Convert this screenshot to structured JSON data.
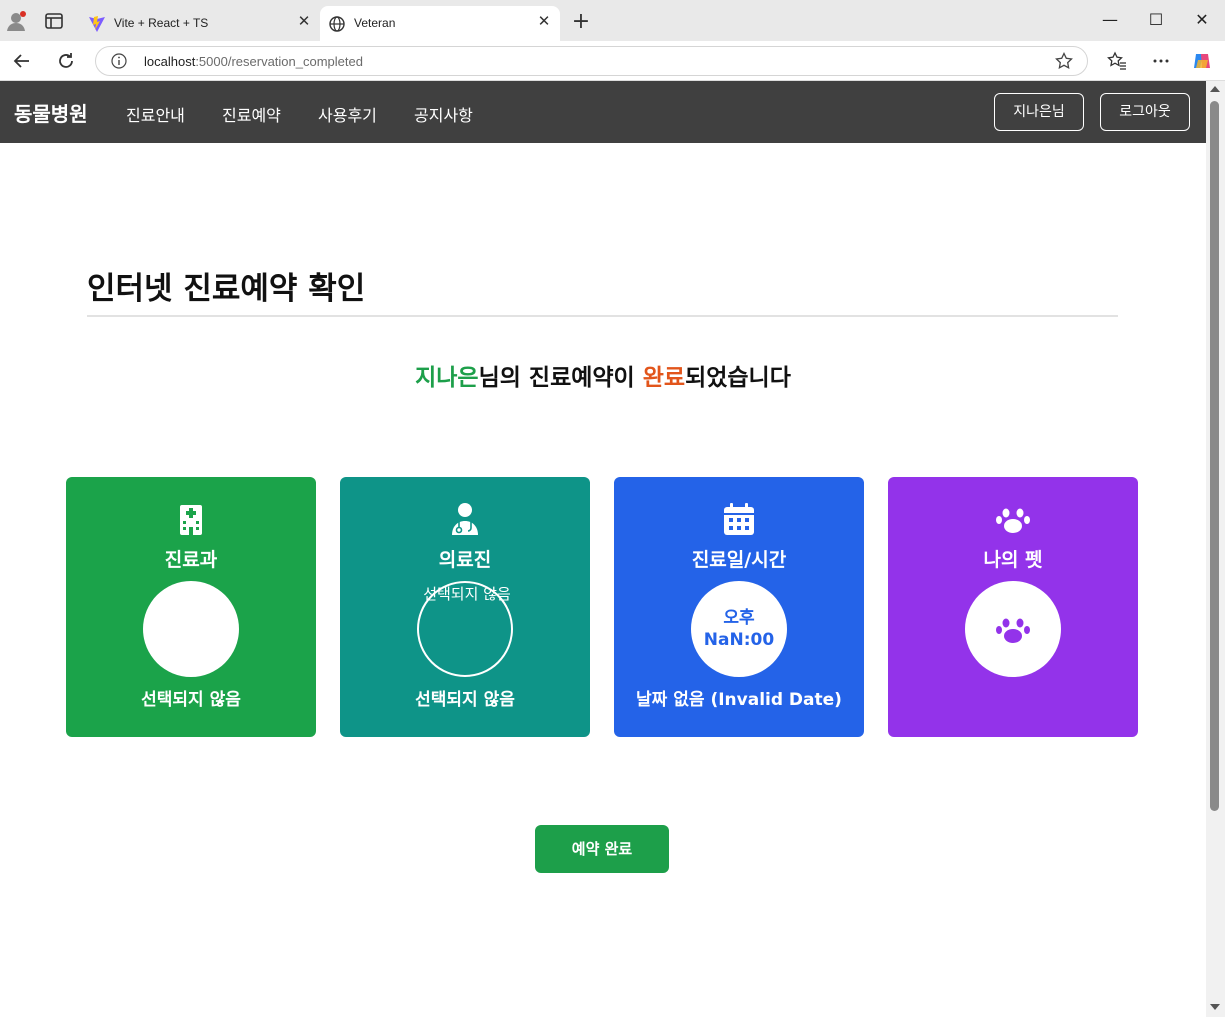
{
  "browser": {
    "tabs": [
      {
        "title": "Vite + React + TS",
        "close": "✕"
      },
      {
        "title": "Veteran",
        "close": "✕"
      }
    ],
    "new_tab": "+",
    "window": {
      "minimize": "—",
      "maximize": "☐",
      "close": "✕"
    },
    "url_host": "localhost",
    "url_rest": ":5000/reservation_completed"
  },
  "navbar": {
    "brand": "동물병원",
    "links": [
      "진료안내",
      "진료예약",
      "사용후기",
      "공지사항"
    ],
    "user_button": "지나은님",
    "logout_button": "로그아웃"
  },
  "main": {
    "title": "인터넷 진료예약 확인",
    "headline": {
      "name": "지나은",
      "part1": "님의 진료예약이 ",
      "done": "완료",
      "part2": "되었습니다"
    },
    "cards": [
      {
        "title": "진료과",
        "subtitle": "선택되지 않음",
        "color": "#1ba34a",
        "icon": "hospital-icon"
      },
      {
        "title": "의료진",
        "circle_text": "선택되지 않음",
        "subtitle": "선택되지 않음",
        "color": "#0e9488",
        "icon": "doctor-icon"
      },
      {
        "title": "진료일/시간",
        "circle_period": "오후",
        "circle_time": "NaN:00",
        "subtitle": "날짜 없음 (Invalid Date)",
        "color": "#2463e8",
        "icon": "calendar-icon"
      },
      {
        "title": "나의 펫",
        "color": "#9333ea",
        "icon": "paw-icon"
      }
    ],
    "confirm_button": "예약 완료"
  }
}
